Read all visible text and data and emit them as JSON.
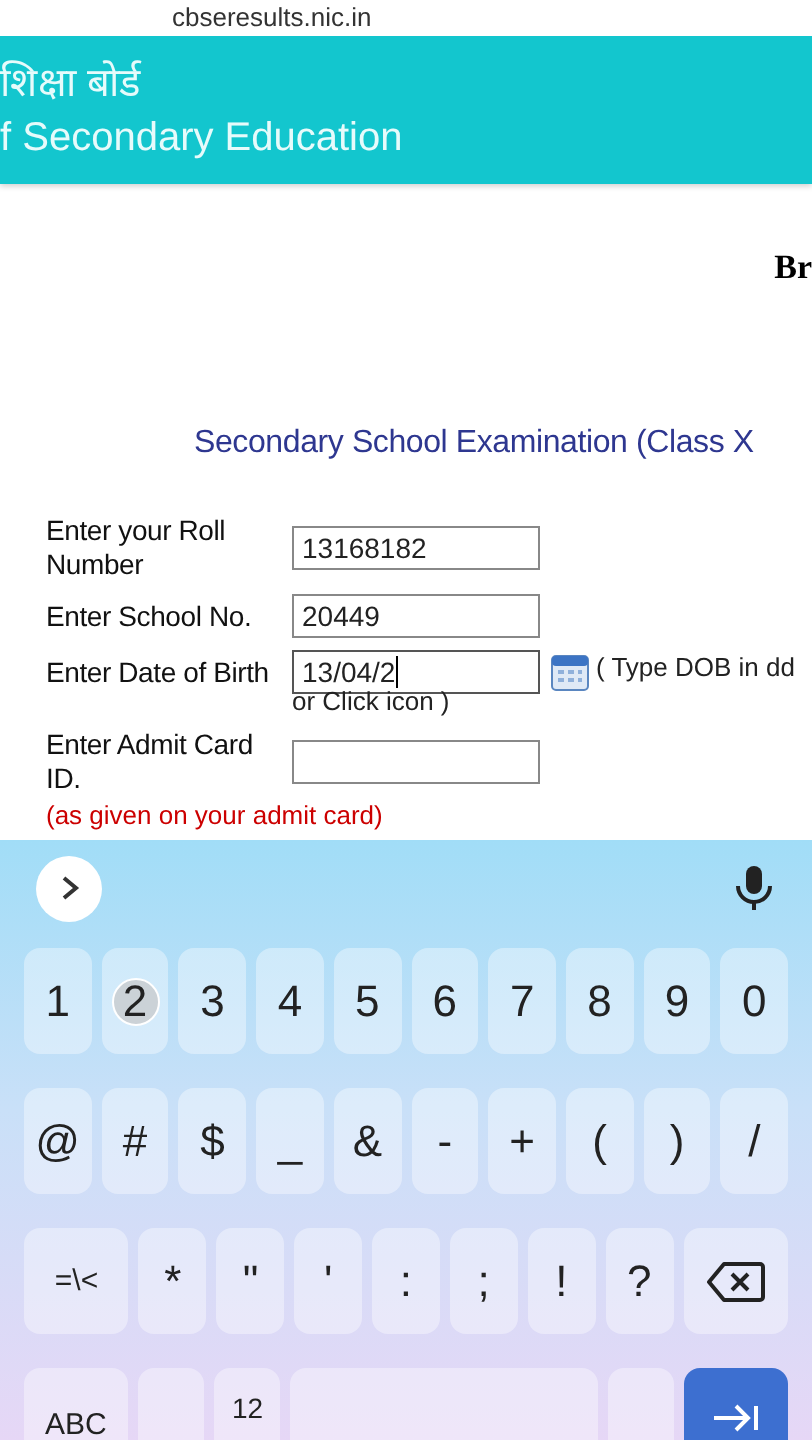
{
  "browser": {
    "url": "cbseresults.nic.in"
  },
  "banner": {
    "hindi_title": "शिक्षा बोर्ड",
    "english_title": "f Secondary Education"
  },
  "side_text": "Br",
  "form": {
    "title": "Secondary School Examination (Class X",
    "fields": [
      {
        "kind": "text",
        "label": "Enter your Roll Number",
        "value": "13168182",
        "focused": false
      },
      {
        "kind": "text",
        "label": "Enter School No.",
        "value": "20449",
        "focused": false
      },
      {
        "kind": "date",
        "label": "Enter Date of Birth",
        "value": "13/04/2",
        "focused": true,
        "hint": "( Type DOB in dd",
        "hint_more": "or Click icon )"
      },
      {
        "kind": "text",
        "label": "Enter Admit Card ID.",
        "focused": false,
        "note": "(as given on your admit card)"
      }
    ]
  },
  "keyboard": {
    "rows": [
      [
        {
          "kind": "char",
          "label": "1",
          "pressed": false
        },
        {
          "kind": "char",
          "label": "2",
          "pressed": true
        },
        {
          "kind": "char",
          "label": "3",
          "pressed": false
        },
        {
          "kind": "char",
          "label": "4",
          "pressed": false
        },
        {
          "kind": "char",
          "label": "5",
          "pressed": false
        },
        {
          "kind": "char",
          "label": "6",
          "pressed": false
        },
        {
          "kind": "char",
          "label": "7",
          "pressed": false
        },
        {
          "kind": "char",
          "label": "8",
          "pressed": false
        },
        {
          "kind": "char",
          "label": "9",
          "pressed": false
        },
        {
          "kind": "char",
          "label": "0",
          "pressed": false
        }
      ],
      [
        {
          "kind": "char",
          "label": "@"
        },
        {
          "kind": "char",
          "label": "#"
        },
        {
          "kind": "char",
          "label": "$"
        },
        {
          "kind": "char",
          "label": "_"
        },
        {
          "kind": "char",
          "label": "&"
        },
        {
          "kind": "char",
          "label": "-"
        },
        {
          "kind": "char",
          "label": "+"
        },
        {
          "kind": "char",
          "label": "("
        },
        {
          "kind": "char",
          "label": ")"
        },
        {
          "kind": "char",
          "label": "/"
        }
      ],
      [
        {
          "kind": "wide",
          "label": "=\\<"
        },
        {
          "kind": "char",
          "label": "*"
        },
        {
          "kind": "char",
          "label": "\""
        },
        {
          "kind": "char",
          "label": "'"
        },
        {
          "kind": "char",
          "label": ":"
        },
        {
          "kind": "char",
          "label": ";"
        },
        {
          "kind": "char",
          "label": "!"
        },
        {
          "kind": "char",
          "label": "?"
        },
        {
          "kind": "backspace"
        }
      ],
      [
        {
          "kind": "wide",
          "label": "ABC"
        },
        {
          "kind": "blank"
        },
        {
          "kind": "small",
          "label": "12"
        },
        {
          "kind": "space"
        },
        {
          "kind": "blank"
        },
        {
          "kind": "enter"
        }
      ]
    ]
  }
}
